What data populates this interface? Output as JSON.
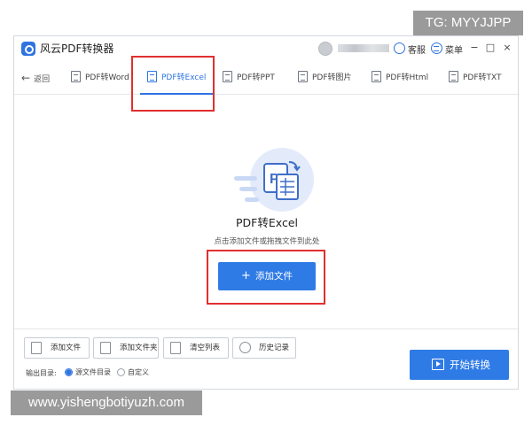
{
  "watermarks": {
    "tg": "TG: MYYJJPP",
    "url": "www.yishengbotiyuzh.com"
  },
  "titlebar": {
    "app_title": "风云PDF转换器",
    "service_label": "客服",
    "menu_label": "菜单",
    "minimize": "−",
    "maximize": "□",
    "close": "×"
  },
  "toolbar": {
    "back_label": "返回",
    "tabs": [
      {
        "label": "PDF转Word",
        "active": false
      },
      {
        "label": "PDF转Excel",
        "active": true
      },
      {
        "label": "PDF转PPT",
        "active": false
      },
      {
        "label": "PDF转图片",
        "active": false
      },
      {
        "label": "PDF转Html",
        "active": false
      },
      {
        "label": "PDF转TXT",
        "active": false
      }
    ]
  },
  "main": {
    "title": "PDF转Excel",
    "hint": "点击添加文件或拖拽文件到此处",
    "add_file_label": "添加文件"
  },
  "bottom": {
    "buttons": [
      "添加文件",
      "添加文件夹",
      "清空列表",
      "历史记录"
    ],
    "output_label": "输出目录:",
    "output_options": [
      {
        "label": "源文件目录",
        "checked": true
      },
      {
        "label": "自定义",
        "checked": false
      }
    ],
    "start_label": "开始转换"
  },
  "colors": {
    "accent": "#2f7be6",
    "highlight": "#e12f2f"
  }
}
